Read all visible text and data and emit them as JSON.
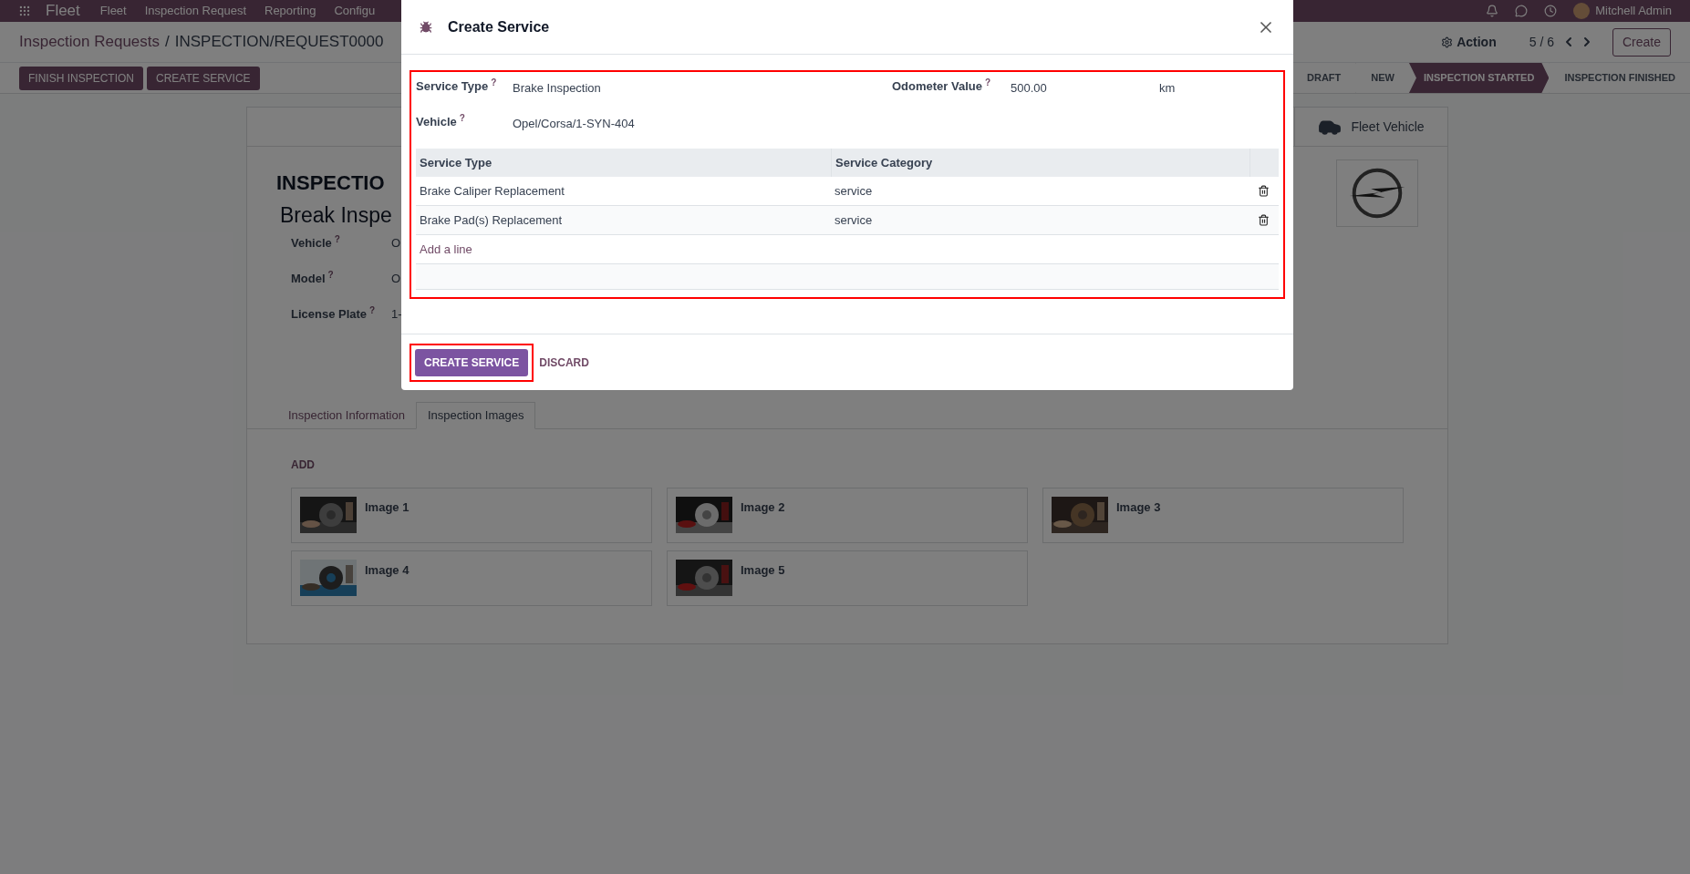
{
  "navbar": {
    "app": "Fleet",
    "menu": [
      "Fleet",
      "Inspection Request",
      "Reporting",
      "Configu"
    ],
    "user": "Mitchell Admin"
  },
  "breadcrumb": {
    "parent": "Inspection Requests",
    "separator": "/",
    "current": "INSPECTION/REQUEST0000"
  },
  "control": {
    "action": "Action",
    "pager": "5 / 6",
    "create": "Create"
  },
  "header_buttons": [
    "FINISH INSPECTION",
    "CREATE SERVICE"
  ],
  "statusbar": [
    {
      "label": "DRAFT",
      "selected": false
    },
    {
      "label": "NEW",
      "selected": false
    },
    {
      "label": "INSPECTION STARTED",
      "selected": true
    },
    {
      "label": "INSPECTION FINISHED",
      "selected": false
    }
  ],
  "sheet": {
    "smart_button": "Fleet Vehicle",
    "title": "INSPECTIO",
    "subtitle": "Break Inspe",
    "fields": [
      {
        "label": "Vehicle",
        "help": "?",
        "value": "O"
      },
      {
        "label": "Model",
        "help": "?",
        "value": "O"
      },
      {
        "label": "License Plate",
        "help": "?",
        "value": "1-"
      }
    ],
    "tabs": [
      {
        "label": "Inspection Information",
        "selected": false
      },
      {
        "label": "Inspection Images",
        "selected": true
      }
    ],
    "add": "ADD",
    "images": [
      {
        "name": "Image 1"
      },
      {
        "name": "Image 2"
      },
      {
        "name": "Image 3"
      },
      {
        "name": "Image 4"
      },
      {
        "name": "Image 5"
      }
    ]
  },
  "dialog": {
    "title": "Create Service",
    "fields": [
      {
        "label": "Service Type",
        "help": "?",
        "value": "Brake Inspection"
      },
      {
        "label": "Odometer Value",
        "help": "?",
        "value": "500.00",
        "unit": "km"
      },
      {
        "label": "Vehicle",
        "help": "?",
        "value": "Opel/Corsa/1-SYN-404"
      }
    ],
    "table": {
      "columns": [
        "Service Type",
        "Service Category"
      ],
      "rows": [
        [
          "Brake Caliper Replacement",
          "service"
        ],
        [
          "Brake Pad(s) Replacement",
          "service"
        ]
      ],
      "add_line": "Add a line"
    },
    "confirm": "CREATE SERVICE",
    "discard": "DISCARD"
  }
}
